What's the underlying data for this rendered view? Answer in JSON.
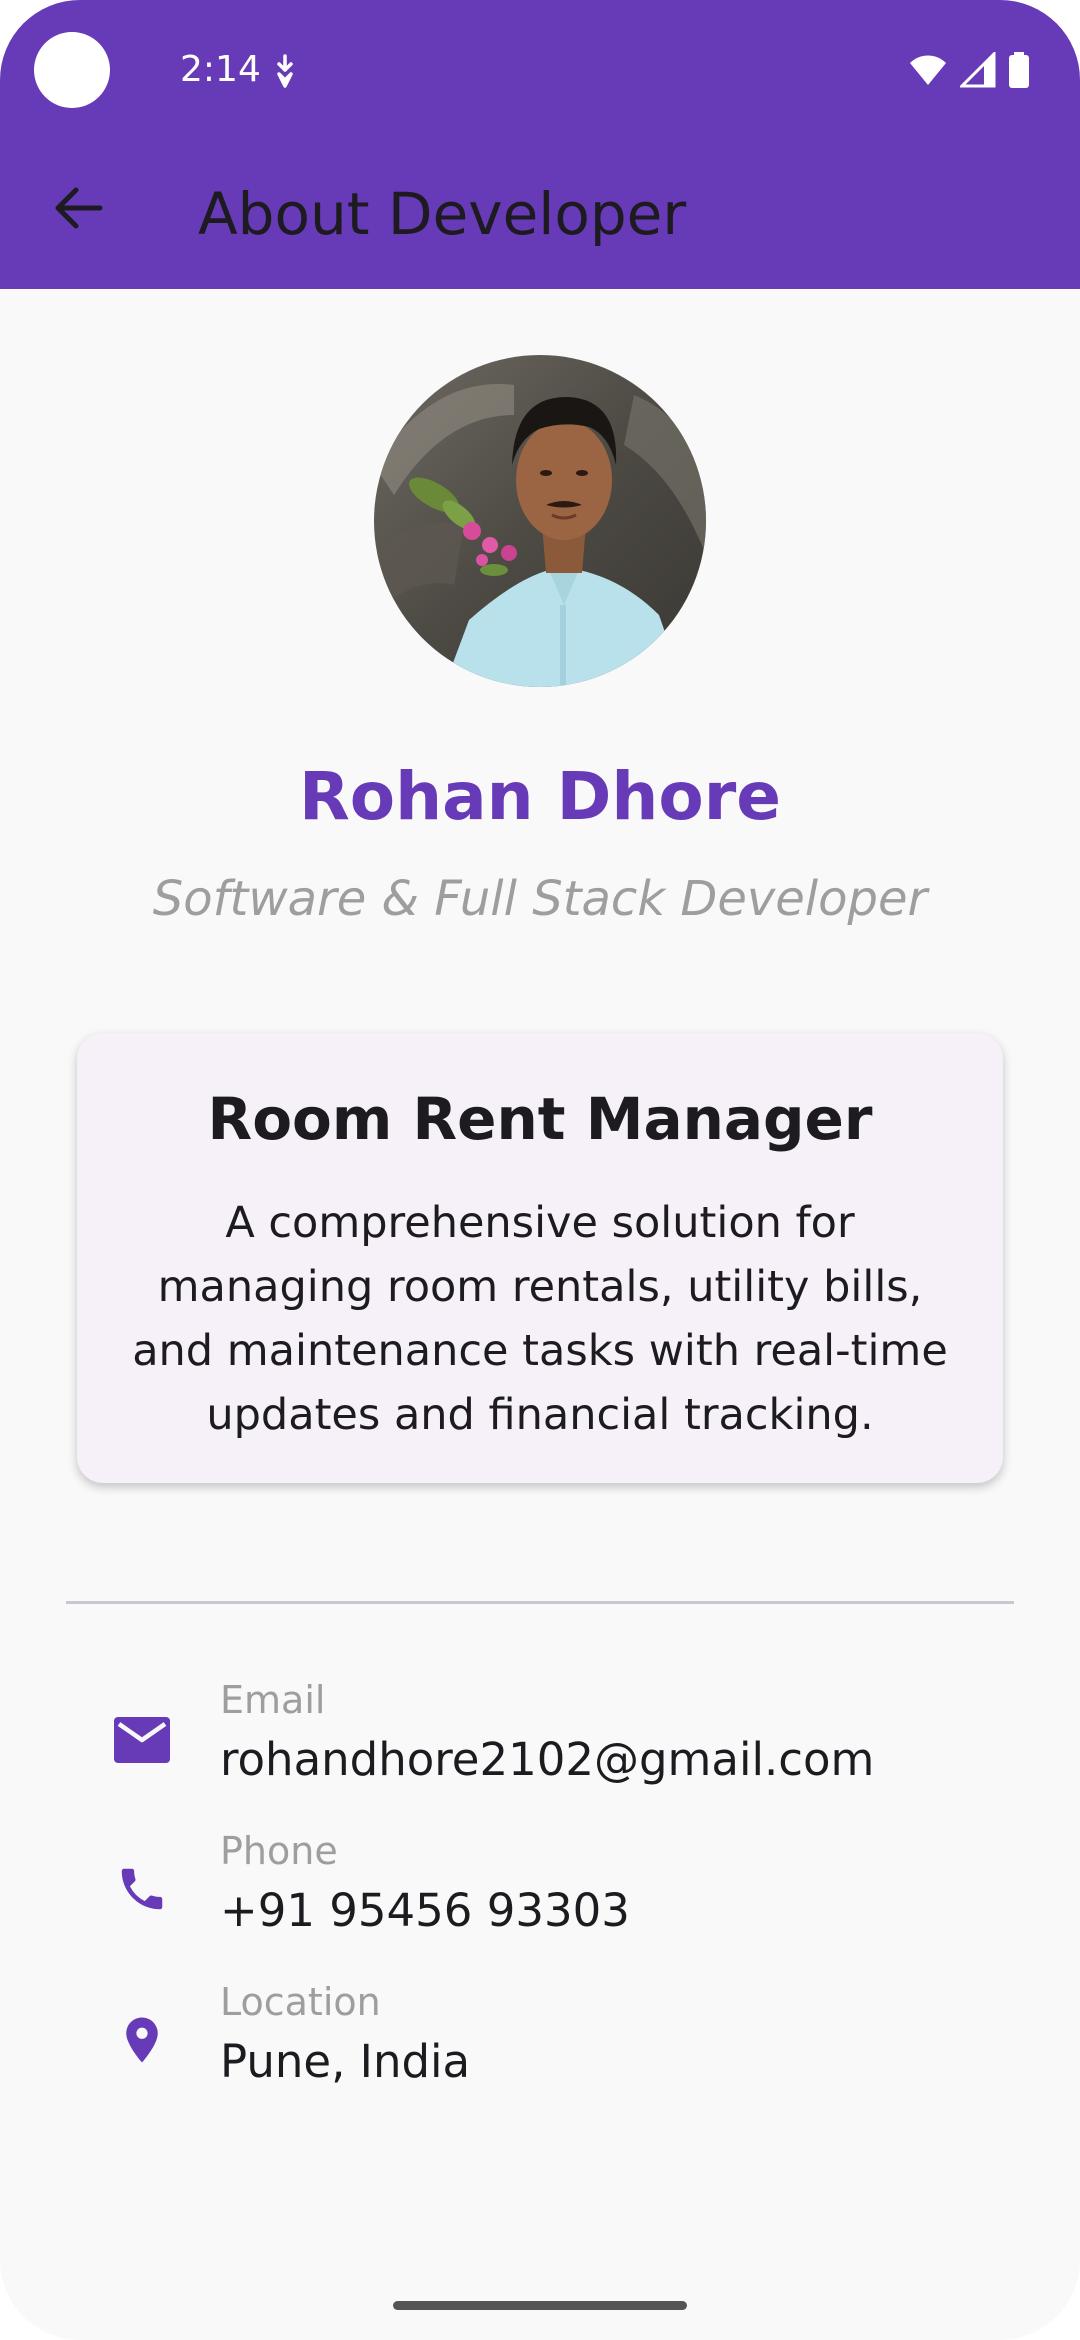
{
  "status_bar": {
    "time": "2:14"
  },
  "app_bar": {
    "title": "About Developer",
    "back_icon": "arrow-back-icon"
  },
  "profile": {
    "name": "Rohan Dhore",
    "role": "Software & Full Stack Developer",
    "avatar": "developer-portrait-photo"
  },
  "project": {
    "title": "Room Rent Manager",
    "description": "A comprehensive solution for managing room rentals, utility bills, and maintenance tasks with real-time updates and financial tracking."
  },
  "contacts": [
    {
      "icon": "email-icon",
      "label": "Email",
      "value": "rohandhore2102@gmail.com"
    },
    {
      "icon": "phone-icon",
      "label": "Phone",
      "value": "+91 95456 93303"
    },
    {
      "icon": "location-pin-icon",
      "label": "Location",
      "value": "Pune, India"
    }
  ],
  "colors": {
    "primary": "#673ab7",
    "background": "#f9f9f9",
    "card": "#f6f1f9",
    "muted_text": "#9e9e9e",
    "text": "#1d1b20"
  }
}
